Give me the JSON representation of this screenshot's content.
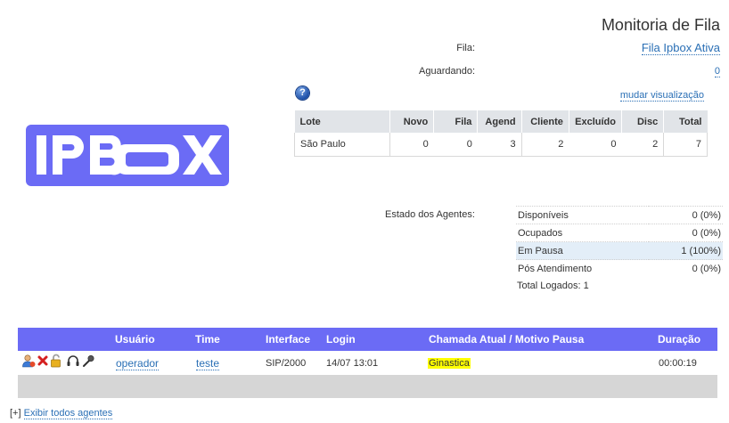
{
  "header": {
    "title": "Monitoria de Fila",
    "queue_label": "Fila:",
    "queue_value": "Fila Ipbox Ativa",
    "waiting_label": "Aguardando:",
    "waiting_value": "0",
    "change_view": "mudar visualização",
    "help_glyph": "?"
  },
  "logo": {
    "text": "IPBOX"
  },
  "lote_table": {
    "columns": [
      "Lote",
      "Novo",
      "Fila",
      "Agend",
      "Cliente",
      "Excluído",
      "Disc",
      "Total"
    ],
    "rows": [
      [
        "São Paulo",
        "0",
        "0",
        "3",
        "2",
        "0",
        "2",
        "7"
      ]
    ]
  },
  "agents_status": {
    "label": "Estado dos Agentes:",
    "rows": [
      {
        "name": "Disponíveis",
        "value": "0 (0%)"
      },
      {
        "name": "Ocupados",
        "value": "0 (0%)"
      },
      {
        "name": "Em Pausa",
        "value": "1 (100%)"
      },
      {
        "name": "Pós Atendimento",
        "value": "0 (0%)"
      }
    ],
    "total": "Total Logados: 1"
  },
  "agent_list": {
    "columns": [
      "Usuário",
      "Time",
      "Interface",
      "Login",
      "Chamada Atual / Motivo Pausa",
      "Duração"
    ],
    "rows": [
      {
        "user": "operador",
        "team": "teste",
        "interface": "SIP/2000",
        "login": "14/07 13:01",
        "current": "Ginastica",
        "duration": "00:00:19"
      }
    ],
    "icons": [
      "user-icon",
      "remove-icon",
      "unlock-icon",
      "headset-icon",
      "microphone-icon"
    ]
  },
  "footer": {
    "show_all_prefix": "[+]",
    "show_all_label": "Exibir todos agentes"
  },
  "colors": {
    "accent": "#6b6bf5",
    "link": "#2a6fb5",
    "highlight": "#ffff00",
    "table_header": "#e1e4e8",
    "row_gray": "#d6d6d6"
  }
}
